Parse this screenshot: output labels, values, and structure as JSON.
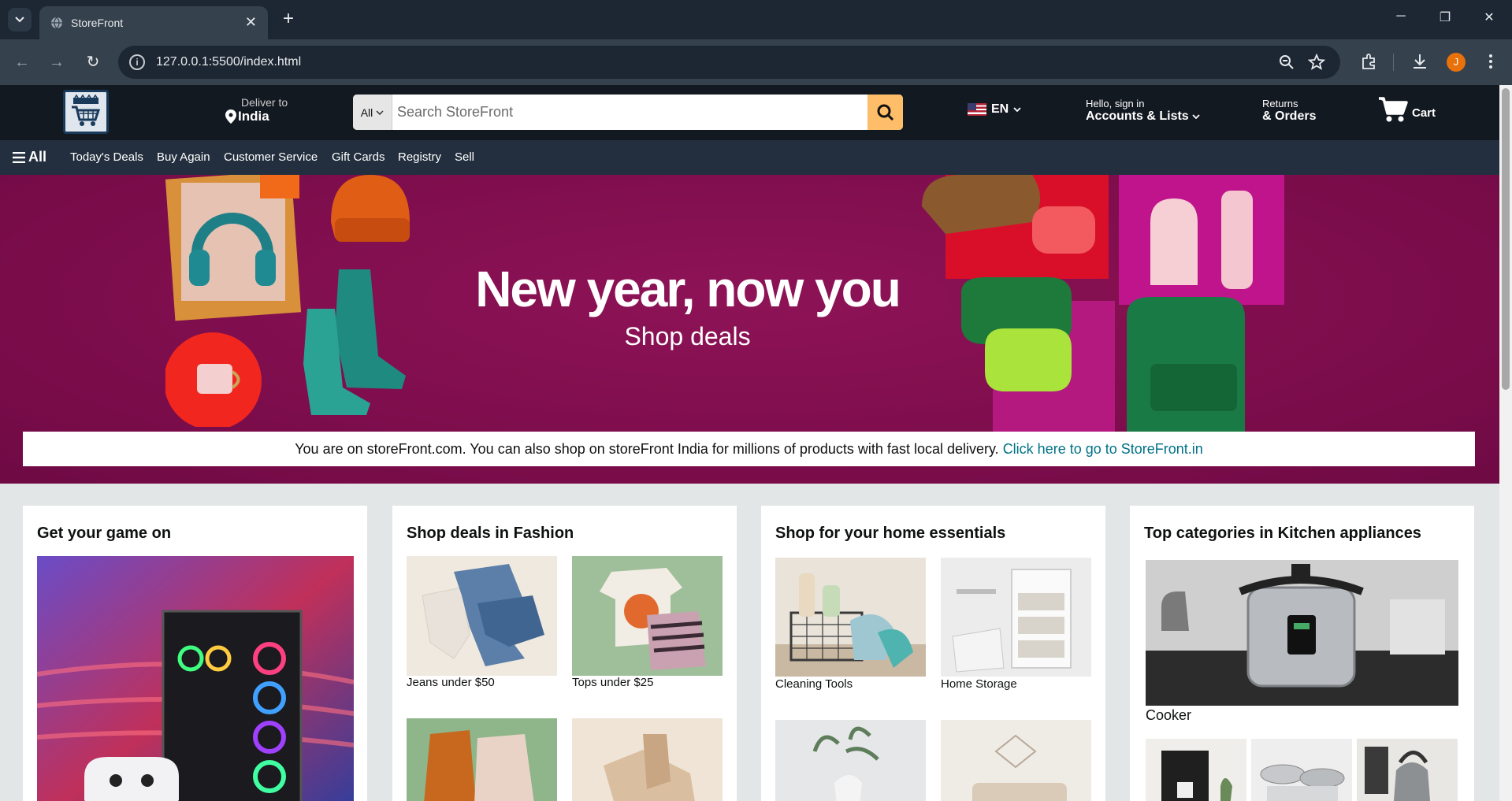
{
  "browser": {
    "tab_title": "StoreFront",
    "url": "127.0.0.1:5500/index.html",
    "profile_initial": "J"
  },
  "header": {
    "deliver_to": "Deliver to",
    "location": "India",
    "search_dept": "All",
    "search_placeholder": "Search StoreFront",
    "language": "EN",
    "account_greeting": "Hello, sign in",
    "account_label": "Accounts & Lists",
    "returns_line1": "Returns",
    "returns_line2": "& Orders",
    "cart_label": "Cart"
  },
  "subnav": {
    "all_label": "All",
    "links": [
      "Today's Deals",
      "Buy Again",
      "Customer Service",
      "Gift Cards",
      "Registry",
      "Sell"
    ]
  },
  "hero": {
    "title": "New year, now you",
    "subtitle": "Shop deals",
    "notice_text": "You are on storeFront.com. You can also shop on storeFront India for millions of products with fast local delivery.",
    "notice_link": "Click here to go to StoreFront.in"
  },
  "cards": [
    {
      "title": "Get your game on"
    },
    {
      "title": "Shop deals in Fashion",
      "items": [
        "Jeans under $50",
        "Tops under $25"
      ]
    },
    {
      "title": "Shop for your home essentials",
      "items": [
        "Cleaning Tools",
        "Home Storage"
      ]
    },
    {
      "title": "Top categories in Kitchen appliances",
      "items": [
        "Cooker"
      ]
    }
  ],
  "colors": {
    "nav_bg": "#131921",
    "subnav_bg": "#232f3e",
    "search_button": "#febd69",
    "hero_bg": "#86104f",
    "link": "#007185"
  }
}
